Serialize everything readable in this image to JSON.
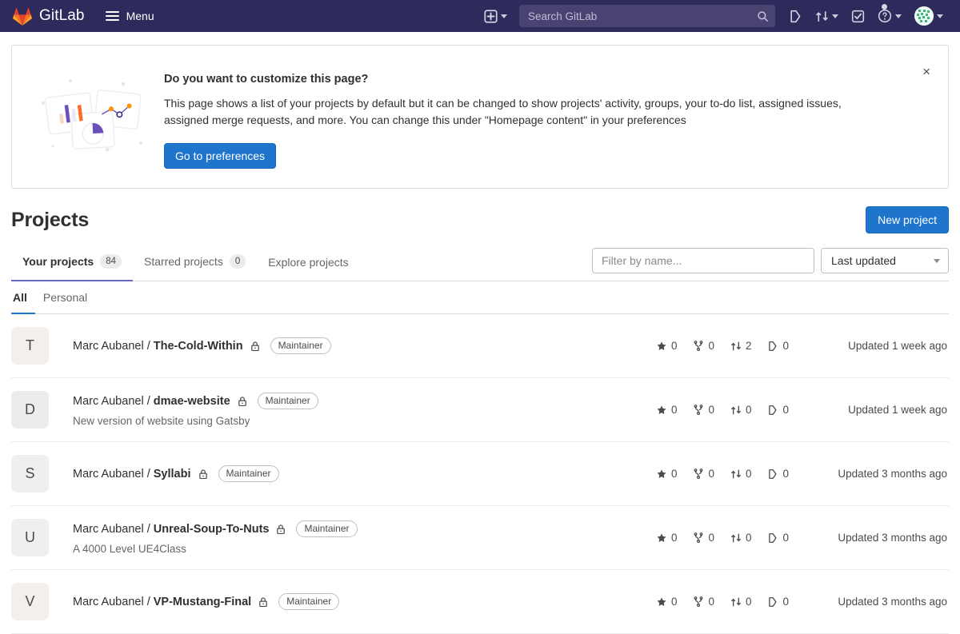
{
  "navbar": {
    "brand": "GitLab",
    "menu_label": "Menu",
    "search_placeholder": "Search GitLab",
    "items": [
      {
        "name": "create-new",
        "icon": "plus-square-icon",
        "caret": true
      },
      {
        "name": "issues",
        "icon": "issues-icon",
        "caret": false
      },
      {
        "name": "merge-requests",
        "icon": "merge-request-icon",
        "caret": true
      },
      {
        "name": "todos",
        "icon": "todo-check-icon",
        "caret": false
      },
      {
        "name": "help",
        "icon": "question-circle-icon",
        "caret": true
      },
      {
        "name": "user-menu",
        "icon": "avatar-icon",
        "caret": true
      }
    ]
  },
  "banner": {
    "title": "Do you want to customize this page?",
    "body": "This page shows a list of your projects by default but it can be changed to show projects' activity, groups, your to-do list, assigned issues, assigned merge requests, and more. You can change this under \"Homepage content\" in your preferences",
    "button_label": "Go to preferences",
    "close_label": "×"
  },
  "projects_header": {
    "title": "Projects",
    "new_project_label": "New project"
  },
  "tabs": [
    {
      "label": "Your projects",
      "count": "84",
      "active": true
    },
    {
      "label": "Starred projects",
      "count": "0",
      "active": false
    },
    {
      "label": "Explore projects",
      "count": null,
      "active": false
    }
  ],
  "filter": {
    "placeholder": "Filter by name...",
    "value": "",
    "sort_value": "Last updated"
  },
  "subtabs": [
    {
      "label": "All",
      "active": true
    },
    {
      "label": "Personal",
      "active": false
    }
  ],
  "stat_icons": {
    "stars": "star-icon",
    "forks": "fork-icon",
    "merge_requests": "merge-request-icon",
    "issues": "issue-icon"
  },
  "colors": {
    "navbar": "#2e2a5b",
    "primary_button": "#1f75cb",
    "active_tab_underline": "#6666c4",
    "subtab_underline": "#1f75cb",
    "brand_orange": "#e24329"
  },
  "projects": [
    {
      "initial": "T",
      "avatar_color": "#f3f0ec",
      "namespace": "Marc Aubanel / ",
      "name": "The-Cold-Within",
      "visibility": "private",
      "role": "Maintainer",
      "description": null,
      "stars": "0",
      "forks": "0",
      "merge_requests": "2",
      "issues": "0",
      "updated": "Updated 1 week ago"
    },
    {
      "initial": "D",
      "avatar_color": "#ececed",
      "namespace": "Marc Aubanel / ",
      "name": "dmae-website",
      "visibility": "private",
      "role": "Maintainer",
      "description": "New version of website using Gatsby",
      "stars": "0",
      "forks": "0",
      "merge_requests": "0",
      "issues": "0",
      "updated": "Updated 1 week ago"
    },
    {
      "initial": "S",
      "avatar_color": "#f0efee",
      "namespace": "Marc Aubanel / ",
      "name": "Syllabi",
      "visibility": "private",
      "role": "Maintainer",
      "description": null,
      "stars": "0",
      "forks": "0",
      "merge_requests": "0",
      "issues": "0",
      "updated": "Updated 3 months ago"
    },
    {
      "initial": "U",
      "avatar_color": "#f0efed",
      "namespace": "Marc Aubanel / ",
      "name": "Unreal-Soup-To-Nuts",
      "visibility": "private",
      "role": "Maintainer",
      "description": "A 4000 Level UE4Class",
      "stars": "0",
      "forks": "0",
      "merge_requests": "0",
      "issues": "0",
      "updated": "Updated 3 months ago"
    },
    {
      "initial": "V",
      "avatar_color": "#f3f0ec",
      "namespace": "Marc Aubanel / ",
      "name": "VP-Mustang-Final",
      "visibility": "private",
      "role": "Maintainer",
      "description": null,
      "stars": "0",
      "forks": "0",
      "merge_requests": "0",
      "issues": "0",
      "updated": "Updated 3 months ago"
    }
  ]
}
